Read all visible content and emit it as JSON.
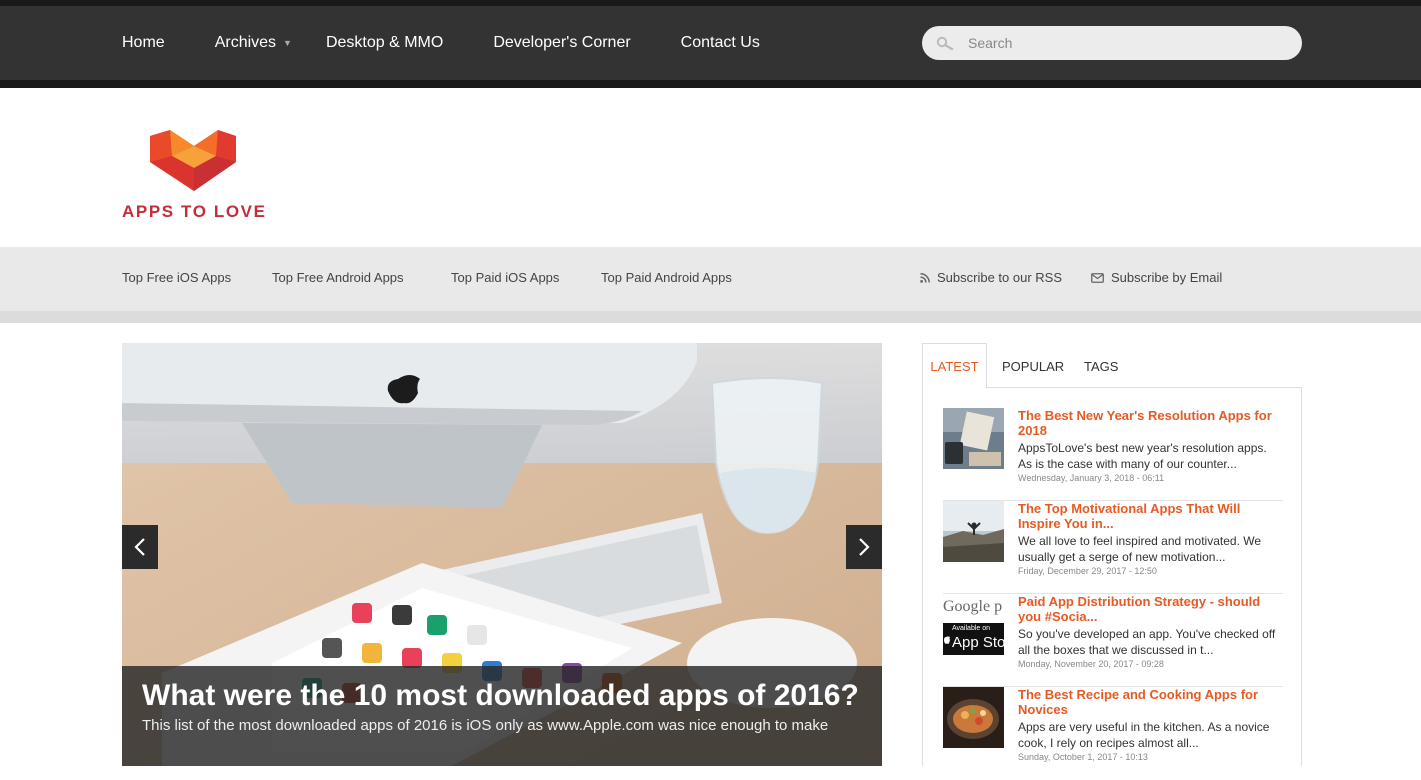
{
  "nav": {
    "items": [
      {
        "label": "Home"
      },
      {
        "label": "Archives"
      },
      {
        "label": "Desktop & MMO"
      },
      {
        "label": "Developer's Corner"
      },
      {
        "label": "Contact Us"
      }
    ],
    "search_placeholder": "Search"
  },
  "brand": {
    "name": "APPS TO LOVE",
    "colors": {
      "logo_orange": "#f05a28",
      "logo_red": "#c42d3a"
    }
  },
  "subnav": {
    "links": [
      {
        "label": "Top Free iOS Apps"
      },
      {
        "label": "Top Free Android Apps"
      },
      {
        "label": "Top Paid iOS Apps"
      },
      {
        "label": "Top Paid Android Apps"
      }
    ],
    "rss_label": "Subscribe to our RSS",
    "email_label": "Subscribe by Email"
  },
  "slider": {
    "title": "What were the 10 most downloaded apps of 2016?",
    "excerpt": "This list of the most downloaded apps of 2016 is iOS only as www.Apple.com was nice enough to make"
  },
  "sidebar": {
    "tabs": [
      {
        "label": "LATEST"
      },
      {
        "label": "POPULAR"
      },
      {
        "label": "TAGS"
      }
    ],
    "accent": "#e65a24",
    "posts": [
      {
        "title": "The Best New Year's Resolution Apps for 2018",
        "excerpt": "AppsToLove's best new year's resolution apps. As is the case with many of our counter...",
        "date": "Wednesday, January 3, 2018 - 06:11"
      },
      {
        "title": "The Top Motivational Apps That Will Inspire You in...",
        "excerpt": "We all love to feel inspired and motivated. We usually get a serge of new motivation...",
        "date": "Friday, December 29, 2017 - 12:50"
      },
      {
        "title": "Paid App Distribution Strategy - should you #Socia...",
        "excerpt": "So you've developed an app. You've checked off all the boxes that we discussed in t...",
        "date": "Monday, November 20, 2017 - 09:28",
        "thumb_texts": {
          "google": "Google p",
          "available": "Available on",
          "store": "App Sto"
        }
      },
      {
        "title": "The Best Recipe and Cooking Apps for Novices",
        "excerpt": "Apps are very useful in the kitchen. As a novice cook, I rely on recipes almost all...",
        "date": "Sunday, October 1, 2017 - 10:13"
      }
    ]
  }
}
